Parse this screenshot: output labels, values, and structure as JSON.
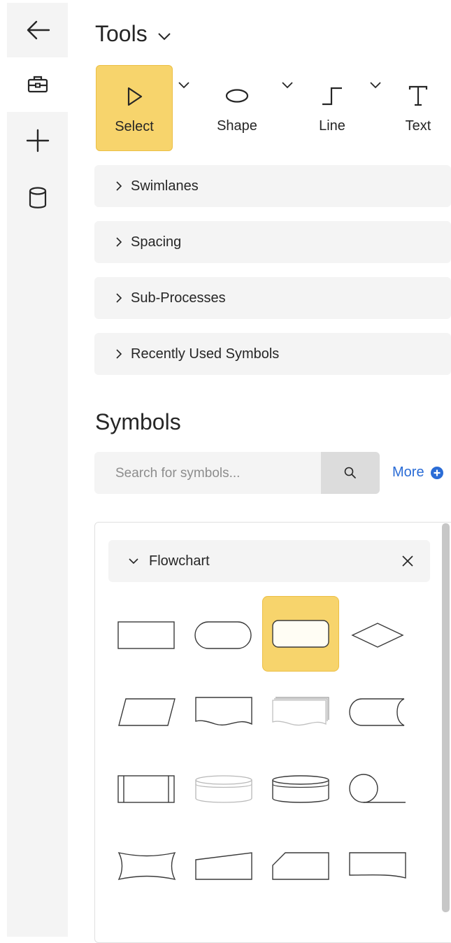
{
  "rail": {
    "items": [
      {
        "icon": "arrow-left-icon",
        "active": false
      },
      {
        "icon": "toolbox-icon",
        "active": true
      },
      {
        "icon": "plus-icon",
        "active": false
      },
      {
        "icon": "database-icon",
        "active": false
      }
    ]
  },
  "tools": {
    "title": "Tools",
    "items": [
      {
        "label": "Select",
        "icon": "select-pointer-icon",
        "selected": true
      },
      {
        "label": "Shape",
        "icon": "ellipse-icon",
        "selected": false
      },
      {
        "label": "Line",
        "icon": "elbow-line-icon",
        "selected": false
      },
      {
        "label": "Text",
        "icon": "text-t-icon",
        "selected": false
      }
    ]
  },
  "sections": [
    {
      "label": "Swimlanes"
    },
    {
      "label": "Spacing"
    },
    {
      "label": "Sub-Processes"
    },
    {
      "label": "Recently Used Symbols"
    }
  ],
  "symbols": {
    "title": "Symbols",
    "search_placeholder": "Search for symbols...",
    "more_label": "More",
    "library": {
      "name": "Flowchart",
      "expanded": true,
      "selected_index": 2,
      "items": [
        "process-rectangle-icon",
        "terminator-icon",
        "rounded-rectangle-icon",
        "decision-diamond-icon",
        "data-parallelogram-icon",
        "document-icon",
        "multi-document-icon",
        "stored-data-icon",
        "predefined-process-icon",
        "internal-storage-cylinder-icon",
        "direct-data-icon",
        "sequential-data-icon",
        "manual-operation-icon",
        "manual-input-icon",
        "card-icon",
        "punched-tape-icon"
      ]
    }
  },
  "colors": {
    "selected_fill": "#f7d46c",
    "selected_border": "#ecbf45",
    "panel_bg": "#f4f4f4",
    "link_blue": "#2a6cd6"
  }
}
